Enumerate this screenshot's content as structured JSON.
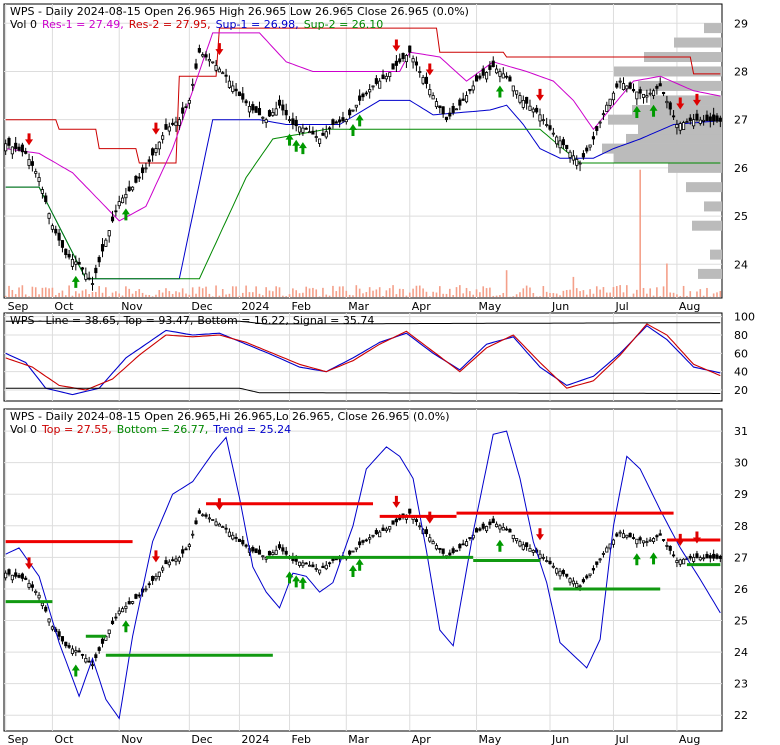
{
  "chart_data": [
    {
      "type": "candlestick",
      "panel": "price",
      "header": [
        {
          "text": "WPS - Daily 2024-08-15 Open 26.965  High 26.965  Low 26.965  Close 26.965 (0.0%)",
          "color": "#000000"
        }
      ],
      "legend": [
        {
          "text": "Vol 0",
          "color": "#000000"
        },
        {
          "text": "Res-1 = 27.49,",
          "color": "#cc00cc"
        },
        {
          "text": "Res-2 = 27.95,",
          "color": "#cc0000"
        },
        {
          "text": "Sup-1 = 26.98,",
          "color": "#0000cc"
        },
        {
          "text": "Sup-2 = 26.10",
          "color": "#008800"
        }
      ],
      "ylim": [
        23.3,
        29.4
      ],
      "y_ticks": [
        24,
        25,
        26,
        27,
        28,
        29
      ],
      "x_labels": [
        "Sep",
        "Oct",
        "Nov",
        "Dec",
        "2024",
        "Feb",
        "Mar",
        "Apr",
        "May",
        "Jun",
        "Jul",
        "Aug"
      ],
      "x_label_index": [
        0,
        14,
        34,
        55,
        70,
        85,
        102,
        121,
        141,
        163,
        182,
        201
      ],
      "n_bars": 215,
      "close_anchors": [
        [
          0,
          26.5
        ],
        [
          6,
          26.3
        ],
        [
          10,
          25.8
        ],
        [
          14,
          24.8
        ],
        [
          18,
          24.2
        ],
        [
          22,
          24.0
        ],
        [
          26,
          23.6
        ],
        [
          30,
          24.5
        ],
        [
          34,
          25.3
        ],
        [
          38,
          25.6
        ],
        [
          42,
          26.0
        ],
        [
          48,
          26.8
        ],
        [
          52,
          27.0
        ],
        [
          55,
          27.4
        ],
        [
          58,
          28.4
        ],
        [
          62,
          28.2
        ],
        [
          66,
          27.9
        ],
        [
          70,
          27.5
        ],
        [
          74,
          27.2
        ],
        [
          78,
          27.0
        ],
        [
          82,
          27.3
        ],
        [
          86,
          26.9
        ],
        [
          90,
          26.8
        ],
        [
          94,
          26.6
        ],
        [
          98,
          26.9
        ],
        [
          102,
          27.0
        ],
        [
          106,
          27.4
        ],
        [
          110,
          27.7
        ],
        [
          114,
          27.9
        ],
        [
          118,
          28.2
        ],
        [
          121,
          28.4
        ],
        [
          124,
          28.0
        ],
        [
          128,
          27.5
        ],
        [
          132,
          27.0
        ],
        [
          136,
          27.3
        ],
        [
          141,
          27.8
        ],
        [
          146,
          28.1
        ],
        [
          150,
          27.9
        ],
        [
          155,
          27.4
        ],
        [
          160,
          27.1
        ],
        [
          163,
          26.8
        ],
        [
          168,
          26.4
        ],
        [
          172,
          26.1
        ],
        [
          176,
          26.6
        ],
        [
          180,
          27.3
        ],
        [
          184,
          27.8
        ],
        [
          188,
          27.6
        ],
        [
          192,
          27.5
        ],
        [
          196,
          27.7
        ],
        [
          201,
          26.9
        ],
        [
          206,
          27.0
        ],
        [
          214,
          26.965
        ]
      ],
      "support_1": [
        [
          0,
          25.6
        ],
        [
          10,
          25.6
        ],
        [
          24,
          23.7
        ],
        [
          52,
          23.7
        ],
        [
          62,
          27.0
        ],
        [
          76,
          27.0
        ],
        [
          84,
          26.9
        ],
        [
          100,
          26.9
        ],
        [
          112,
          27.4
        ],
        [
          121,
          27.4
        ],
        [
          128,
          27.1
        ],
        [
          145,
          27.2
        ],
        [
          150,
          27.3
        ],
        [
          155,
          26.9
        ],
        [
          160,
          26.4
        ],
        [
          166,
          26.2
        ],
        [
          176,
          26.2
        ],
        [
          182,
          26.4
        ],
        [
          190,
          26.6
        ],
        [
          200,
          26.9
        ],
        [
          214,
          26.98
        ]
      ],
      "support_2": [
        [
          0,
          25.6
        ],
        [
          10,
          25.6
        ],
        [
          24,
          23.7
        ],
        [
          58,
          23.7
        ],
        [
          66,
          24.9
        ],
        [
          72,
          25.8
        ],
        [
          80,
          26.6
        ],
        [
          96,
          26.8
        ],
        [
          110,
          26.8
        ],
        [
          160,
          26.8
        ],
        [
          172,
          26.1
        ],
        [
          214,
          26.1
        ]
      ],
      "resistance_1": [
        [
          0,
          26.4
        ],
        [
          10,
          26.3
        ],
        [
          20,
          25.9
        ],
        [
          34,
          24.9
        ],
        [
          42,
          25.2
        ],
        [
          50,
          26.4
        ],
        [
          56,
          27.6
        ],
        [
          62,
          28.8
        ],
        [
          76,
          28.8
        ],
        [
          84,
          28.2
        ],
        [
          92,
          28.0
        ],
        [
          106,
          28.0
        ],
        [
          118,
          28.0
        ],
        [
          121,
          28.4
        ],
        [
          130,
          28.3
        ],
        [
          138,
          27.8
        ],
        [
          146,
          28.2
        ],
        [
          156,
          28.0
        ],
        [
          164,
          27.8
        ],
        [
          170,
          27.4
        ],
        [
          176,
          26.8
        ],
        [
          182,
          27.3
        ],
        [
          188,
          27.8
        ],
        [
          196,
          27.9
        ],
        [
          206,
          27.6
        ],
        [
          214,
          27.49
        ]
      ],
      "resistance_2": [
        [
          0,
          27.0
        ],
        [
          6,
          27.0
        ],
        [
          16,
          26.8
        ],
        [
          28,
          26.4
        ],
        [
          40,
          26.1
        ],
        [
          52,
          27.9
        ],
        [
          64,
          28.9
        ],
        [
          110,
          28.9
        ],
        [
          130,
          28.4
        ],
        [
          150,
          28.3
        ],
        [
          168,
          28.3
        ],
        [
          200,
          28.3
        ],
        [
          206,
          27.95
        ],
        [
          214,
          27.95
        ]
      ],
      "volume_spikes": [
        [
          190,
          0.95
        ],
        [
          150,
          0.2
        ],
        [
          198,
          0.25
        ],
        [
          170,
          0.15
        ]
      ],
      "volume_profile": [
        [
          23.8,
          0.2
        ],
        [
          24.2,
          0.1
        ],
        [
          24.8,
          0.25
        ],
        [
          25.2,
          0.15
        ],
        [
          25.6,
          0.3
        ],
        [
          26.0,
          0.45
        ],
        [
          26.2,
          0.9
        ],
        [
          26.4,
          1.0
        ],
        [
          26.6,
          0.8
        ],
        [
          26.8,
          0.7
        ],
        [
          27.0,
          0.95
        ],
        [
          27.2,
          0.75
        ],
        [
          27.4,
          0.6
        ],
        [
          27.7,
          0.7
        ],
        [
          28.0,
          0.9
        ],
        [
          28.3,
          0.65
        ],
        [
          28.6,
          0.4
        ],
        [
          28.9,
          0.15
        ]
      ],
      "buy_arrows": [
        21,
        36,
        85,
        87,
        89,
        104,
        106,
        148,
        189,
        194
      ],
      "sell_arrows": [
        7,
        45,
        64,
        117,
        127,
        160,
        202,
        207
      ]
    },
    {
      "type": "line",
      "panel": "oscillator",
      "header": [
        {
          "text": "WPS - Line = 38.65,",
          "color": "#000000"
        },
        {
          "text": " Top = 93.47,",
          "color": "#000000"
        },
        {
          "text": " Bottom = 16.22,",
          "color": "#000000"
        },
        {
          "text": " Signal = 35.74",
          "color": "#000000"
        }
      ],
      "ylim": [
        8,
        104
      ],
      "y_ticks": [
        20,
        40,
        60,
        80,
        100
      ],
      "series": [
        {
          "role": "line",
          "color": "#0000cc",
          "anchors": [
            [
              0,
              60
            ],
            [
              6,
              50
            ],
            [
              12,
              22
            ],
            [
              20,
              15
            ],
            [
              28,
              22
            ],
            [
              36,
              55
            ],
            [
              42,
              70
            ],
            [
              48,
              85
            ],
            [
              56,
              80
            ],
            [
              64,
              82
            ],
            [
              72,
              70
            ],
            [
              80,
              58
            ],
            [
              88,
              45
            ],
            [
              96,
              40
            ],
            [
              104,
              55
            ],
            [
              112,
              72
            ],
            [
              120,
              82
            ],
            [
              128,
              60
            ],
            [
              136,
              42
            ],
            [
              144,
              70
            ],
            [
              152,
              78
            ],
            [
              160,
              45
            ],
            [
              168,
              25
            ],
            [
              176,
              35
            ],
            [
              184,
              60
            ],
            [
              192,
              90
            ],
            [
              198,
              75
            ],
            [
              206,
              45
            ],
            [
              214,
              38.65
            ]
          ]
        },
        {
          "role": "signal",
          "color": "#cc0000",
          "anchors": [
            [
              0,
              55
            ],
            [
              8,
              45
            ],
            [
              16,
              25
            ],
            [
              24,
              20
            ],
            [
              32,
              32
            ],
            [
              40,
              58
            ],
            [
              48,
              80
            ],
            [
              56,
              78
            ],
            [
              64,
              80
            ],
            [
              72,
              72
            ],
            [
              80,
              60
            ],
            [
              88,
              48
            ],
            [
              96,
              40
            ],
            [
              104,
              52
            ],
            [
              112,
              70
            ],
            [
              120,
              84
            ],
            [
              128,
              62
            ],
            [
              136,
              40
            ],
            [
              144,
              66
            ],
            [
              152,
              80
            ],
            [
              160,
              50
            ],
            [
              168,
              22
            ],
            [
              176,
              30
            ],
            [
              184,
              58
            ],
            [
              192,
              92
            ],
            [
              198,
              80
            ],
            [
              206,
              48
            ],
            [
              214,
              35.74
            ]
          ]
        },
        {
          "role": "top",
          "color": "#000000",
          "anchors": [
            [
              0,
              95
            ],
            [
              70,
              95
            ],
            [
              78,
              92
            ],
            [
              214,
              93.47
            ]
          ]
        },
        {
          "role": "bottom",
          "color": "#000000",
          "anchors": [
            [
              0,
              22
            ],
            [
              70,
              22
            ],
            [
              76,
              17
            ],
            [
              214,
              16.22
            ]
          ]
        }
      ],
      "x_label_index": [
        0,
        14,
        34,
        55,
        70,
        85,
        102,
        121,
        141,
        163,
        182,
        201
      ],
      "n_bars": 215
    },
    {
      "type": "candlestick",
      "panel": "trend",
      "header": [
        {
          "text": "WPS - Daily 2024-08-15 Open 26.965,Hi 26.965,Lo 26.965, Close 26.965 (0.0%)",
          "color": "#000000"
        }
      ],
      "legend": [
        {
          "text": "Vol 0",
          "color": "#000000"
        },
        {
          "text": "Top = 27.55,",
          "color": "#cc0000"
        },
        {
          "text": "Bottom = 26.77,",
          "color": "#008800"
        },
        {
          "text": "Trend = 25.24",
          "color": "#0000cc"
        }
      ],
      "ylim": [
        21.5,
        31.7
      ],
      "y_ticks": [
        22,
        23,
        24,
        25,
        26,
        27,
        28,
        29,
        30,
        31
      ],
      "x_labels": [
        "Sep",
        "Oct",
        "Nov",
        "Dec",
        "2024",
        "Feb",
        "Mar",
        "Apr",
        "May",
        "Jun",
        "Jul",
        "Aug"
      ],
      "x_label_index": [
        0,
        14,
        34,
        55,
        70,
        85,
        102,
        121,
        141,
        163,
        182,
        201
      ],
      "n_bars": 215,
      "trend": [
        [
          0,
          27.1
        ],
        [
          4,
          27.3
        ],
        [
          10,
          26.4
        ],
        [
          16,
          24.3
        ],
        [
          22,
          22.6
        ],
        [
          26,
          23.8
        ],
        [
          30,
          22.5
        ],
        [
          34,
          21.9
        ],
        [
          38,
          24.5
        ],
        [
          44,
          27.5
        ],
        [
          50,
          29.0
        ],
        [
          56,
          29.4
        ],
        [
          62,
          30.3
        ],
        [
          66,
          30.8
        ],
        [
          70,
          28.9
        ],
        [
          74,
          26.7
        ],
        [
          78,
          25.9
        ],
        [
          82,
          25.4
        ],
        [
          86,
          26.5
        ],
        [
          90,
          26.4
        ],
        [
          94,
          25.9
        ],
        [
          98,
          26.2
        ],
        [
          104,
          28.0
        ],
        [
          108,
          29.8
        ],
        [
          114,
          30.5
        ],
        [
          118,
          30.2
        ],
        [
          122,
          29.5
        ],
        [
          126,
          27.2
        ],
        [
          130,
          24.7
        ],
        [
          134,
          24.2
        ],
        [
          140,
          27.8
        ],
        [
          146,
          30.9
        ],
        [
          150,
          31.0
        ],
        [
          154,
          29.5
        ],
        [
          158,
          27.5
        ],
        [
          162,
          26.2
        ],
        [
          166,
          24.3
        ],
        [
          170,
          23.9
        ],
        [
          174,
          23.5
        ],
        [
          178,
          24.4
        ],
        [
          182,
          28.0
        ],
        [
          186,
          30.2
        ],
        [
          190,
          29.8
        ],
        [
          196,
          28.5
        ],
        [
          202,
          27.3
        ],
        [
          208,
          26.3
        ],
        [
          214,
          25.24
        ]
      ],
      "red_levels": [
        [
          0,
          27.5,
          38
        ],
        [
          60,
          28.7,
          110
        ],
        [
          112,
          28.3,
          135
        ],
        [
          135,
          28.4,
          200
        ],
        [
          198,
          27.55,
          214
        ]
      ],
      "green_levels": [
        [
          0,
          25.6,
          14
        ],
        [
          24,
          24.5,
          30
        ],
        [
          30,
          23.9,
          80
        ],
        [
          78,
          27.0,
          140
        ],
        [
          140,
          26.9,
          160
        ],
        [
          164,
          26.0,
          196
        ],
        [
          204,
          26.77,
          214
        ]
      ],
      "buy_arrows": [
        21,
        36,
        85,
        87,
        89,
        104,
        106,
        148,
        189,
        194
      ],
      "sell_arrows": [
        7,
        45,
        64,
        117,
        127,
        160,
        202,
        207
      ]
    }
  ]
}
